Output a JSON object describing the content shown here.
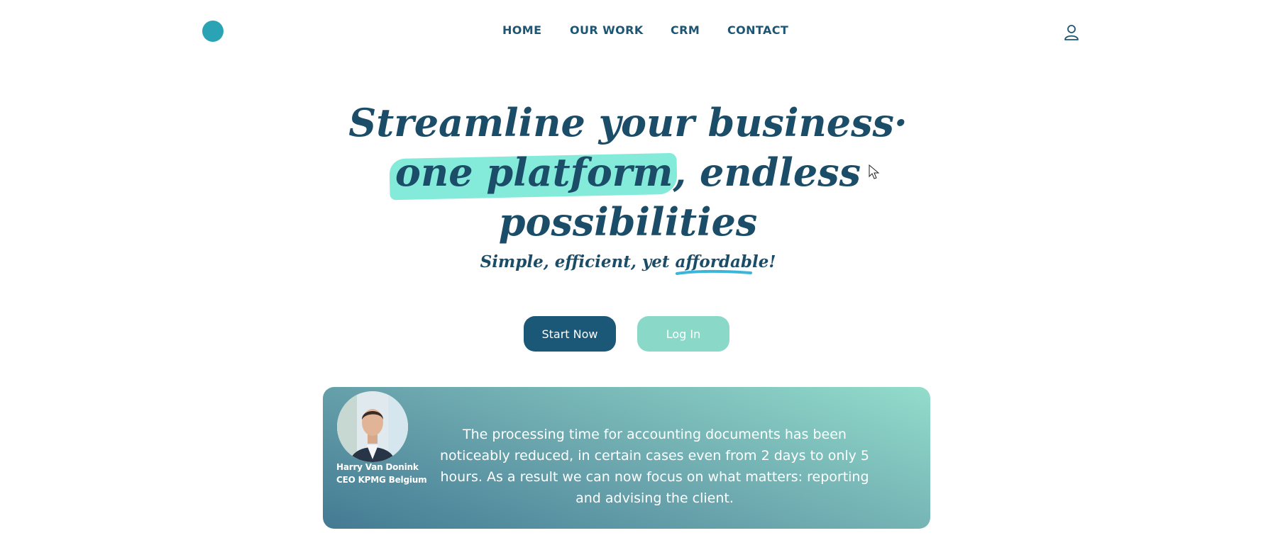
{
  "header": {
    "logo": {
      "icon": "brand-logo-icon",
      "colors": [
        "#2fb7c8",
        "#4fd1dc",
        "#2aa4b4"
      ]
    },
    "nav": [
      {
        "label": "HOME"
      },
      {
        "label": "OUR WORK"
      },
      {
        "label": "CRM"
      },
      {
        "label": "CONTACT"
      }
    ],
    "account_icon": "user-icon"
  },
  "hero": {
    "title_line1": "Streamline your business·",
    "title_highlight": "one platform",
    "title_after_highlight": ", endless",
    "title_line3": "possibilities",
    "subtitle_prefix": "Simple, efficient, yet ",
    "subtitle_emphasis": "affordable!",
    "highlight_color": "#84ead9",
    "underline_color": "#3bb5d8"
  },
  "buttons": {
    "start_label": "Start Now",
    "login_label": "Log In"
  },
  "testimonial": {
    "name": "Harry Van Donink",
    "role": "CEO KPMG Belgium",
    "quote": "The processing time for accounting documents has been noticeably reduced, in certain cases even from 2 days to only 5 hours. As a result we can now focus on what matters: reporting and advising the client."
  },
  "colors": {
    "primary": "#1b5776",
    "secondary": "#8ad9c8",
    "text": "#1b4d68"
  }
}
